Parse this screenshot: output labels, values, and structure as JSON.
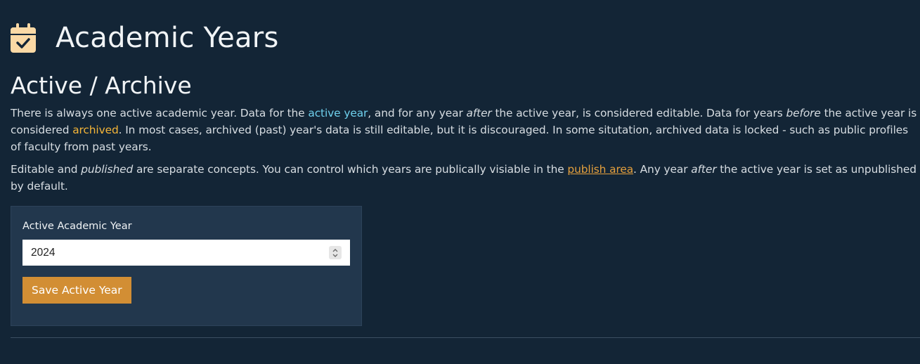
{
  "header": {
    "title": "Academic Years",
    "icon": "calendar-check-icon",
    "icon_color": "#fbd9a5"
  },
  "section": {
    "title": "Active / Archive"
  },
  "paragraph1": {
    "t1": "There is always one active academic year. Data for the ",
    "active_year": "active year",
    "t2": ", and for any year ",
    "after": "after",
    "t3": " the active year, is considered editable. Data for years ",
    "before": "before",
    "t4": " the active year is considered ",
    "archived": "archived",
    "t5": ". In most cases, archived (past) year's data is still editable, but it is discouraged. In some situtation, archived data is locked - such as public profiles of faculty from past years."
  },
  "paragraph2": {
    "t1": "Editable and ",
    "published": "published",
    "t2": " are separate concepts. You can control which years are publically visiable in the ",
    "publish_link": "publish area",
    "t3": ". Any year ",
    "after": "after",
    "t4": " the active year is set as unpublished by default."
  },
  "form": {
    "label": "Active Academic Year",
    "year_value": "2024",
    "save_label": "Save Active Year"
  },
  "colors": {
    "background": "#132536",
    "card": "#22374d",
    "accent_blue": "#6fd1ee",
    "accent_orange": "#f5b538",
    "link": "#e5a03d",
    "button": "#d28e34"
  }
}
